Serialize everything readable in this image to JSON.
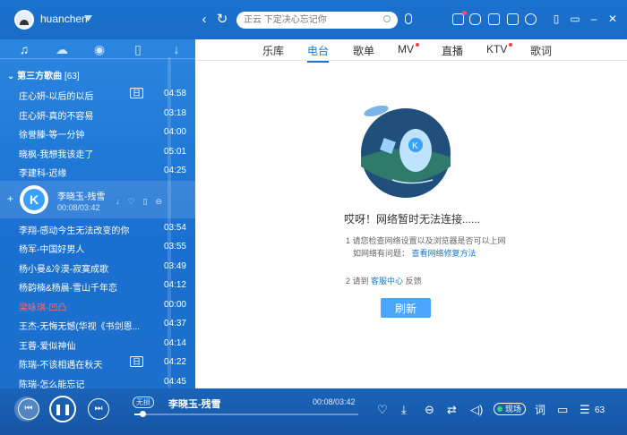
{
  "user": {
    "name": "huanchen"
  },
  "search": {
    "placeholder": "正云 下定决心忘记你"
  },
  "side_tabs": [
    {
      "icon": "music-note-icon"
    },
    {
      "icon": "cloud-icon"
    },
    {
      "icon": "radio-icon"
    },
    {
      "icon": "phone-icon"
    },
    {
      "icon": "download-icon"
    }
  ],
  "playlist": {
    "title": "第三方歌曲",
    "count": "[63]",
    "songs": [
      {
        "name": "庄心妍-以后的以后",
        "duration": "04:58",
        "badge": "日"
      },
      {
        "name": "庄心妍-真的不容易",
        "duration": "03:18"
      },
      {
        "name": "徐誉滕-等一分钟",
        "duration": "04:00"
      },
      {
        "name": "晓枫-我想我该走了",
        "duration": "05:01"
      },
      {
        "name": "李建科-迟缘",
        "duration": "04:25"
      }
    ],
    "current": {
      "name": "李晓玉-残雪",
      "time": "00:08/03:42",
      "actions": "↓♡▯⊖"
    },
    "songs_after": [
      {
        "name": "李翔-感动今生无法改变的你",
        "duration": "03:54"
      },
      {
        "name": "杨军-中国好男人",
        "duration": "03:55"
      },
      {
        "name": "杨小曼&冷漠-寂寞成歌",
        "duration": "03:49"
      },
      {
        "name": "杨韵楠&杨晨-雪山千年恋",
        "duration": "04:12"
      },
      {
        "name": "梁咏琪-凹凸",
        "duration": "00:00",
        "red": true
      },
      {
        "name": "王杰-无悔无憾(华视《书剑恩...",
        "duration": "04:37"
      },
      {
        "name": "王蓉-爱似神仙",
        "duration": "04:14"
      },
      {
        "name": "陈瑞-不该相遇在秋天",
        "duration": "04:22",
        "badge": "日"
      },
      {
        "name": "陈瑞-怎么能忘记",
        "duration": "04:45"
      }
    ]
  },
  "tabs": [
    {
      "label": "乐库",
      "active": false
    },
    {
      "label": "电台",
      "active": true
    },
    {
      "label": "歌单",
      "active": false
    },
    {
      "label": "MV",
      "active": false,
      "dot": true
    },
    {
      "label": "直播",
      "active": false
    },
    {
      "label": "KTV",
      "active": false,
      "dot": true
    },
    {
      "label": "歌词",
      "active": false
    }
  ],
  "error": {
    "title": "哎呀！网络暂时无法连接......",
    "hint1": "1 请您检查网络设置以及浏览器是否可以上网",
    "hint2_prefix": "如网络有问题：",
    "hint2_link": "查看网络修复方法",
    "hint3_prefix": "2 请到",
    "hint3_link": "客服中心",
    "hint3_suffix": "反馈",
    "refresh": "刷新"
  },
  "player": {
    "quality": "无损",
    "title": "李晓玉-残雪",
    "time": "00:08/03:42",
    "progress": 0.036,
    "live_label": "现场",
    "lyric_label": "词",
    "count": "63"
  },
  "colors": {
    "accent": "#1a78d2",
    "sidebar": "#1c6fcb",
    "live_dot": "#3bd16f",
    "alert": "#ff3b3b"
  }
}
